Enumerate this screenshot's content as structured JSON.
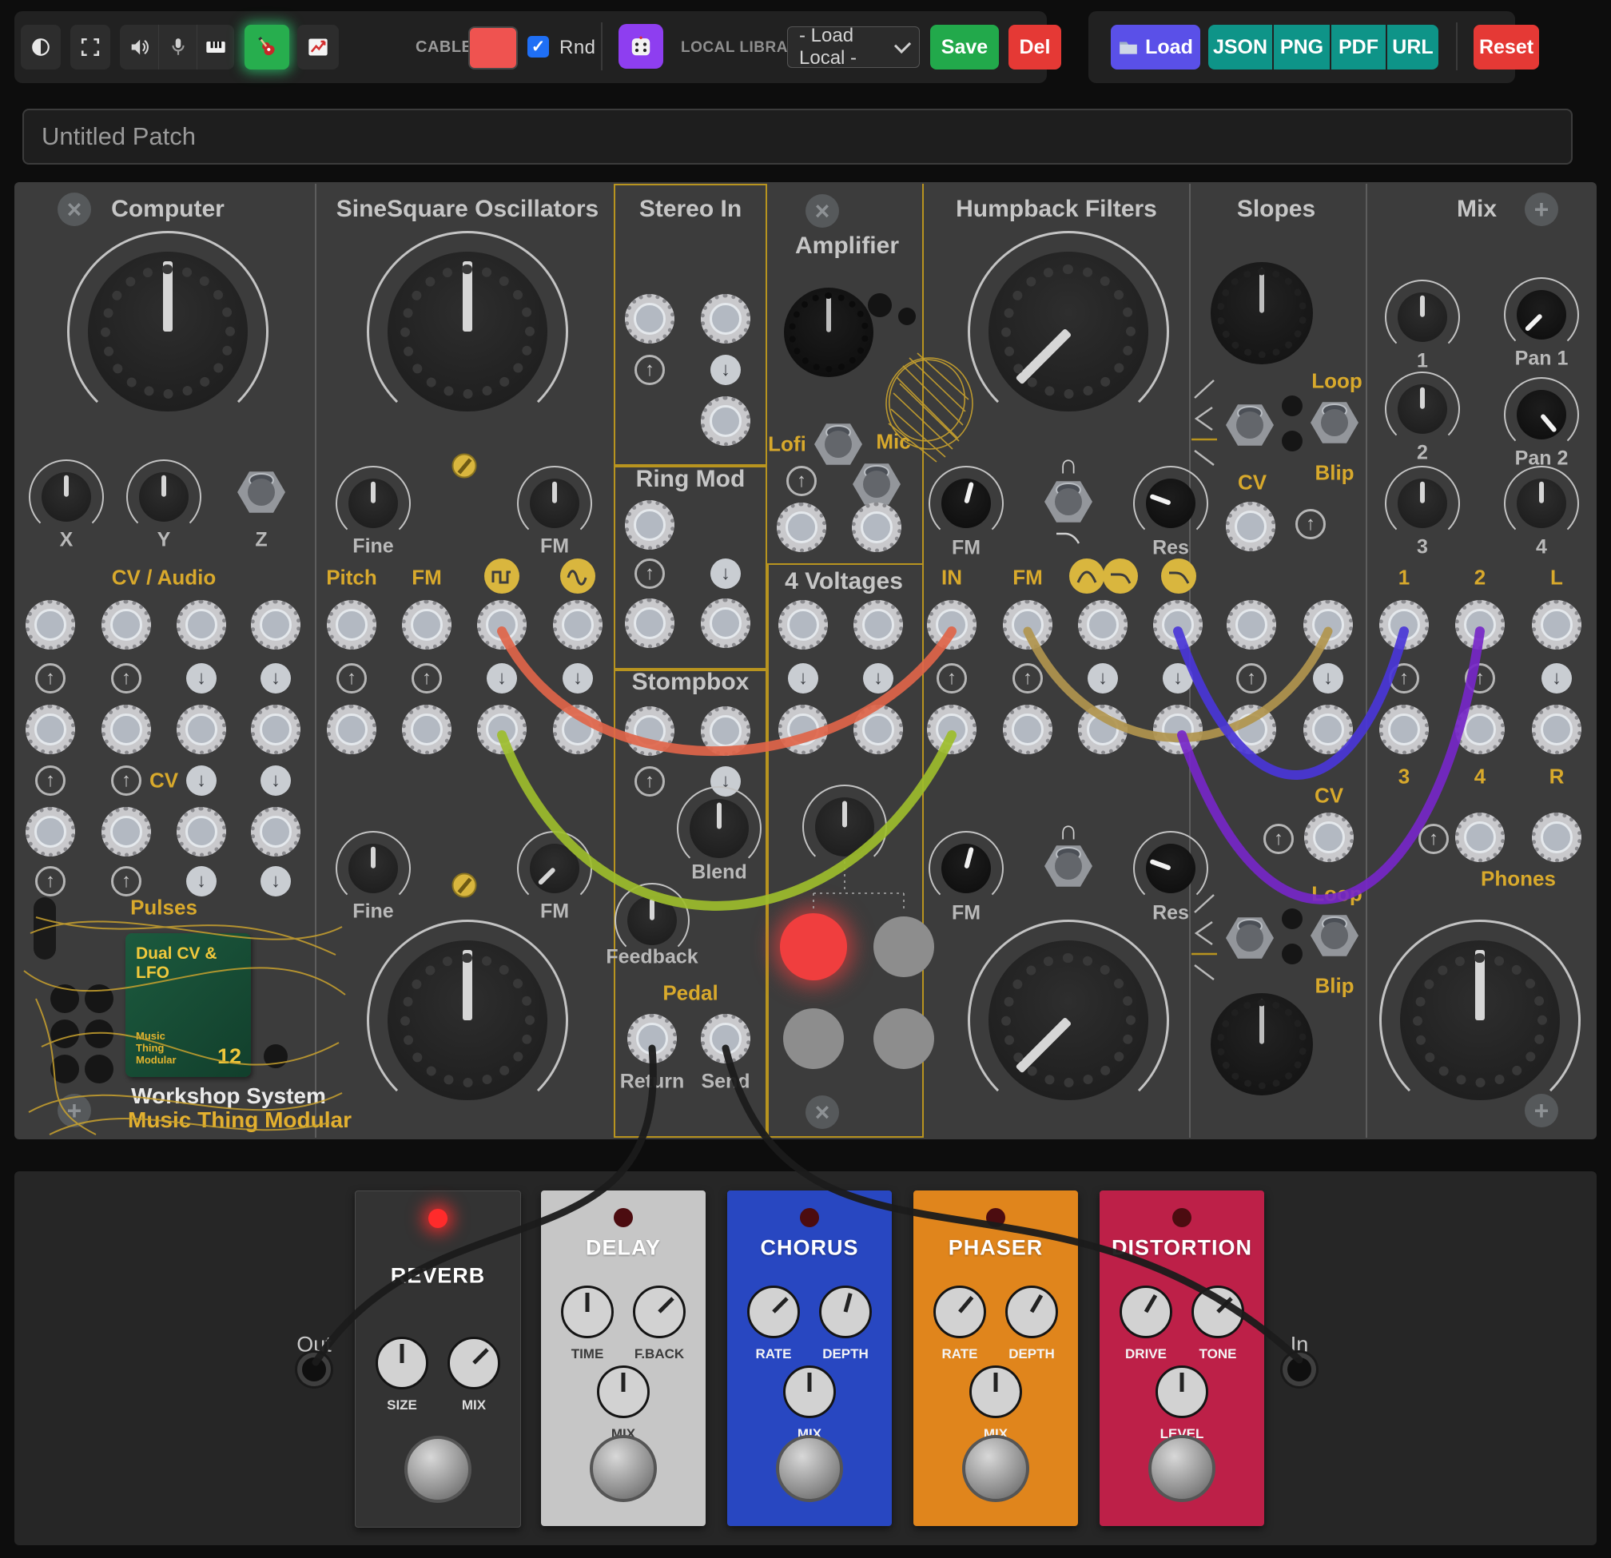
{
  "toolbar": {
    "cable_label": "CABLE",
    "rnd_label": "Rnd",
    "rnd_checked": "checked",
    "local_library_label": "LOCAL LIBRARY",
    "load_local_option": "- Load Local -",
    "save": "Save",
    "del": "Del",
    "load": "Load",
    "json": "JSON",
    "png": "PNG",
    "pdf": "PDF",
    "url": "URL",
    "reset": "Reset"
  },
  "patch": {
    "name": "Untitled Patch"
  },
  "modules": {
    "computer": {
      "title": "Computer",
      "x": "X",
      "y": "Y",
      "z": "Z",
      "cv_audio": "CV / Audio",
      "cv": "CV",
      "pulses": "Pulses",
      "card": {
        "title": "Dual CV & LFO",
        "brand": "Music\nThing\nModular",
        "slot": "12"
      },
      "brand1": "Workshop System",
      "brand2": "Music Thing Modular"
    },
    "oscillators": {
      "title": "SineSquare Oscillators",
      "fine": "Fine",
      "fm": "FM",
      "pitch": "Pitch"
    },
    "stereo_in": {
      "title": "Stereo In"
    },
    "ring_mod": {
      "title": "Ring Mod"
    },
    "stompbox": {
      "title": "Stompbox",
      "blend": "Blend",
      "feedback": "Feedback",
      "pedal": "Pedal",
      "return_label": "Return",
      "send_label": "Send"
    },
    "amplifier": {
      "title": "Amplifier",
      "lofi": "Lofi",
      "mic": "Mic"
    },
    "four_voltages": {
      "title": "4 Voltages"
    },
    "humpback": {
      "title": "Humpback Filters",
      "fm": "FM",
      "res": "Res",
      "input": "IN"
    },
    "slopes": {
      "title": "Slopes",
      "loop": "Loop",
      "blip": "Blip",
      "cv": "CV"
    },
    "mix": {
      "title": "Mix",
      "k1": "1",
      "k2": "2",
      "k3": "3",
      "k4": "4",
      "pan1": "Pan 1",
      "pan2": "Pan 2",
      "j1": "1",
      "j2": "2",
      "jl": "L",
      "j3": "3",
      "j4": "4",
      "jr": "R",
      "phones": "Phones"
    }
  },
  "pedalboard": {
    "out_label": "Out",
    "in_label": "In",
    "pedals": [
      {
        "name": "REVERB",
        "color": "#333333",
        "knobs": [
          "SIZE",
          "MIX"
        ],
        "led_on": true
      },
      {
        "name": "DELAY",
        "color": "#c6c6c6",
        "knobs": [
          "TIME",
          "F.BACK",
          "MIX"
        ],
        "led_on": false
      },
      {
        "name": "CHORUS",
        "color": "#2847c1",
        "knobs": [
          "RATE",
          "DEPTH",
          "MIX"
        ],
        "led_on": false
      },
      {
        "name": "PHASER",
        "color": "#e0851c",
        "knobs": [
          "RATE",
          "DEPTH",
          "MIX"
        ],
        "led_on": false
      },
      {
        "name": "DISTORTION",
        "color": "#bd2048",
        "knobs": [
          "DRIVE",
          "TONE",
          "LEVEL"
        ],
        "led_on": false
      }
    ]
  },
  "cables": {
    "orange": "#e0654a",
    "green": "#9dbd2c",
    "tan": "#b1954e",
    "blue": "#4a36d8",
    "violet": "#7627c8",
    "black": "#1b1b1b"
  },
  "colors": {
    "panel_yellow": "#b8941f",
    "badge_yellow": "#d9b63e",
    "cable_swatch": "#ef5350",
    "save_green": "#22a94b",
    "danger_red": "#e53935",
    "load_purple": "#5a50e8",
    "export_teal": "#0e9488",
    "dice_purple": "#8e3ef0",
    "guitar_active_green": "#27ae4e"
  }
}
